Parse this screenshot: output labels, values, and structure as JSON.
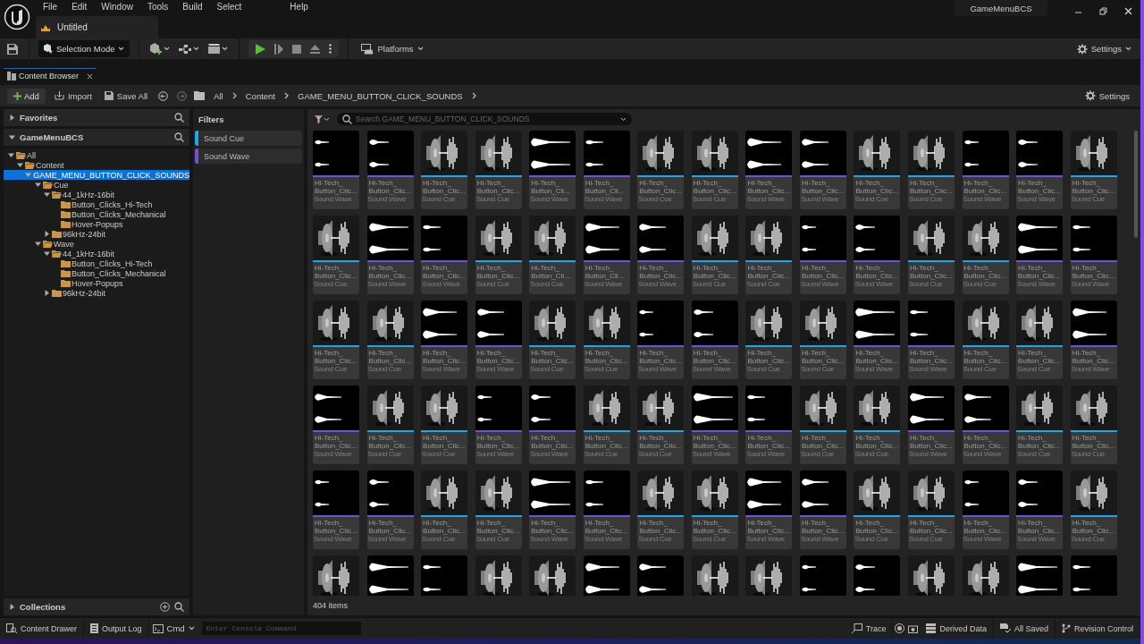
{
  "menu": [
    "File",
    "Edit",
    "Window",
    "Tools",
    "Build",
    "Select",
    "Help"
  ],
  "document_tab": {
    "title": "Untitled"
  },
  "project": "GameMenuBCS",
  "toolbar": {
    "mode": "Selection Mode",
    "platforms": "Platforms",
    "settings": "Settings"
  },
  "panel_tab": {
    "title": "Content Browser",
    "selected": true
  },
  "browser_toolbar": {
    "add": "Add",
    "import": "Import",
    "save_all": "Save All",
    "breadcrumb": [
      "All",
      "Content",
      "GAME_MENU_BUTTON_CLICK_SOUNDS"
    ],
    "settings": "Settings"
  },
  "sources": {
    "favorites": {
      "title": "Favorites",
      "expanded": false
    },
    "project": {
      "title": "GameMenuBCS",
      "expanded": true
    },
    "collections": {
      "title": "Collections",
      "expanded": false
    }
  },
  "tree": [
    {
      "label": "All",
      "expanded": true,
      "selected": false,
      "children": [
        {
          "label": "Content",
          "expanded": true,
          "selected": false,
          "children": [
            {
              "label": "GAME_MENU_BUTTON_CLICK_SOUNDS",
              "expanded": true,
              "selected": true,
              "children": [
                {
                  "label": "Cue",
                  "expanded": true,
                  "selected": false,
                  "children": [
                    {
                      "label": "44_1kHz-16bit",
                      "expanded": true,
                      "selected": false,
                      "children": [
                        {
                          "label": "Button_Clicks_Hi-Tech",
                          "selected": false
                        },
                        {
                          "label": "Button_Clicks_Mechanical",
                          "selected": false
                        },
                        {
                          "label": "Hover-Popups",
                          "selected": false
                        }
                      ]
                    },
                    {
                      "label": "96kHz-24bit",
                      "expanded": false,
                      "selected": false
                    }
                  ]
                },
                {
                  "label": "Wave",
                  "expanded": true,
                  "selected": false,
                  "children": [
                    {
                      "label": "44_1kHz-16bit",
                      "expanded": true,
                      "selected": false,
                      "children": [
                        {
                          "label": "Button_Clicks_Hi-Tech",
                          "selected": false
                        },
                        {
                          "label": "Button_Clicks_Mechanical",
                          "selected": false
                        },
                        {
                          "label": "Hover-Popups",
                          "selected": false
                        }
                      ]
                    },
                    {
                      "label": "96kHz-24bit",
                      "expanded": false,
                      "selected": false
                    }
                  ]
                }
              ]
            }
          ]
        }
      ]
    }
  ],
  "filters": {
    "title": "Filters",
    "items": [
      {
        "label": "Sound Cue",
        "color": "#1ea7e8"
      },
      {
        "label": "Sound Wave",
        "color": "#7350d8"
      }
    ]
  },
  "search": {
    "placeholder": "Search GAME_MENU_BUTTON_CLICK_SOUNDS"
  },
  "assets": [
    {
      "kind": "wave",
      "name": "Hi-Tech_",
      "name2": "Button_Clic...",
      "type": "Sound Wave"
    },
    {
      "kind": "wave",
      "name": "Hi-Tech_",
      "name2": "Button_Clic...",
      "type": "Sound Wave"
    },
    {
      "kind": "cue",
      "name": "Hi-Tech_",
      "name2": "Button_Clic...",
      "type": "Sound Cue"
    },
    {
      "kind": "cue",
      "name": "Hi-Tech_",
      "name2": "Button_Clic...",
      "type": "Sound Cue"
    },
    {
      "kind": "wave",
      "name": "Hi-Tech_",
      "name2": "Button_Cli...",
      "type": "Sound Wave"
    },
    {
      "kind": "wave",
      "name": "Hi-Tech_",
      "name2": "Button_Cli...",
      "type": "Sound Wave"
    },
    {
      "kind": "cue",
      "name": "Hi-Tech_",
      "name2": "Button_Clic...",
      "type": "Sound Cue"
    },
    {
      "kind": "cue",
      "name": "Hi-Tech_",
      "name2": "Button_Clic...",
      "type": "Sound Cue"
    },
    {
      "kind": "wave",
      "name": "Hi-Tech_",
      "name2": "Button_Clic...",
      "type": "Sound Wave"
    },
    {
      "kind": "wave",
      "name": "Hi-Tech_",
      "name2": "Button_Clic...",
      "type": "Sound Wave"
    },
    {
      "kind": "cue",
      "name": "Hi-Tech_",
      "name2": "Button_Clic...",
      "type": "Sound Cue"
    },
    {
      "kind": "cue",
      "name": "Hi-Tech_",
      "name2": "Button_Clic...",
      "type": "Sound Cue"
    },
    {
      "kind": "wave",
      "name": "Hi-Tech_",
      "name2": "Button_Clic...",
      "type": "Sound Wave"
    },
    {
      "kind": "wave",
      "name": "Hi-Tech_",
      "name2": "Button_Clic...",
      "type": "Sound Wave"
    },
    {
      "kind": "cue",
      "name": "Hi-Tech_",
      "name2": "Button_Clic...",
      "type": "Sound Cue"
    },
    {
      "kind": "cue",
      "name": "Hi-Tech_",
      "name2": "Button_Clic...",
      "type": "Sound Cue"
    },
    {
      "kind": "wave",
      "name": "Hi-Tech_",
      "name2": "Button_Clic...",
      "type": "Sound Wave"
    },
    {
      "kind": "wave",
      "name": "Hi-Tech_",
      "name2": "Button_Clic...",
      "type": "Sound Wave"
    },
    {
      "kind": "cue",
      "name": "Hi-Tech_",
      "name2": "Button_Clic...",
      "type": "Sound Cue"
    },
    {
      "kind": "cue",
      "name": "Hi-Tech_",
      "name2": "Button_Cli...",
      "type": "Sound Cue"
    },
    {
      "kind": "wave",
      "name": "Hi-Tech_",
      "name2": "Button_Cli...",
      "type": "Sound Wave"
    },
    {
      "kind": "wave",
      "name": "Hi-Tech_",
      "name2": "Button_Clic...",
      "type": "Sound Wave"
    },
    {
      "kind": "cue",
      "name": "Hi-Tech_",
      "name2": "Button_Clic...",
      "type": "Sound Cue"
    },
    {
      "kind": "cue",
      "name": "Hi-Tech_",
      "name2": "Button_Clic...",
      "type": "Sound Cue"
    },
    {
      "kind": "wave",
      "name": "Hi-Tech_",
      "name2": "Button_Clic...",
      "type": "Sound Wave"
    },
    {
      "kind": "wave",
      "name": "Hi-Tech_",
      "name2": "Button_Clic...",
      "type": "Sound Wave"
    },
    {
      "kind": "cue",
      "name": "Hi-Tech_",
      "name2": "Button_Clic...",
      "type": "Sound Cue"
    },
    {
      "kind": "cue",
      "name": "Hi-Tech_",
      "name2": "Button_Clic...",
      "type": "Sound Cue"
    },
    {
      "kind": "wave",
      "name": "Hi-Tech_",
      "name2": "Button_Clic...",
      "type": "Sound Wave"
    },
    {
      "kind": "wave",
      "name": "Hi-Tech_",
      "name2": "Button_Clic...",
      "type": "Sound Wave"
    },
    {
      "kind": "cue",
      "name": "Hi-Tech_",
      "name2": "Button_Clic...",
      "type": "Sound Cue"
    },
    {
      "kind": "cue",
      "name": "Hi-Tech_",
      "name2": "Button_Clic...",
      "type": "Sound Cue"
    },
    {
      "kind": "wave",
      "name": "Hi-Tech_",
      "name2": "Button_Clic...",
      "type": "Sound Wave"
    },
    {
      "kind": "wave",
      "name": "Hi-Tech_",
      "name2": "Button_Clic...",
      "type": "Sound Wave"
    },
    {
      "kind": "cue",
      "name": "Hi-Tech_",
      "name2": "Button_Clic...",
      "type": "Sound Cue"
    },
    {
      "kind": "cue",
      "name": "Hi-Tech_",
      "name2": "Button_Clic...",
      "type": "Sound Cue"
    },
    {
      "kind": "wave",
      "name": "Hi-Tech_",
      "name2": "Button_Clic...",
      "type": "Sound Wave"
    },
    {
      "kind": "wave",
      "name": "Hi-Tech_",
      "name2": "Button_Clic...",
      "type": "Sound Wave"
    },
    {
      "kind": "cue",
      "name": "Hi-Tech_",
      "name2": "Button_Clic...",
      "type": "Sound Cue"
    },
    {
      "kind": "cue",
      "name": "Hi-Tech_",
      "name2": "Button_Clic...",
      "type": "Sound Cue"
    },
    {
      "kind": "wave",
      "name": "Hi-Tech_",
      "name2": "Button_Clic...",
      "type": "Sound Wave"
    },
    {
      "kind": "wave",
      "name": "Hi-Tech_",
      "name2": "Button_Clic...",
      "type": "Sound Wave"
    },
    {
      "kind": "cue",
      "name": "Hi-Tech_",
      "name2": "Button_Clic...",
      "type": "Sound Cue"
    },
    {
      "kind": "cue",
      "name": "Hi-Tech_",
      "name2": "Button_Clic...",
      "type": "Sound Cue"
    },
    {
      "kind": "wave",
      "name": "Hi-Tech_",
      "name2": "Button_Clic...",
      "type": "Sound Wave"
    },
    {
      "kind": "wave",
      "name": "Hi-Tech_",
      "name2": "Button_Clic...",
      "type": "Sound Wave"
    },
    {
      "kind": "cue",
      "name": "Hi-Tech_",
      "name2": "Button_Clic...",
      "type": "Sound Cue"
    },
    {
      "kind": "cue",
      "name": "Hi-Tech_",
      "name2": "Button_Clic...",
      "type": "Sound Cue"
    },
    {
      "kind": "wave",
      "name": "Hi-Tech_",
      "name2": "Button_Clic...",
      "type": "Sound Wave"
    },
    {
      "kind": "wave",
      "name": "Hi-Tech_",
      "name2": "Button_Clic...",
      "type": "Sound Wave"
    },
    {
      "kind": "cue",
      "name": "Hi-Tech_",
      "name2": "Button_Clic...",
      "type": "Sound Cue"
    },
    {
      "kind": "cue",
      "name": "Hi-Tech_",
      "name2": "Button_Clic...",
      "type": "Sound Cue"
    },
    {
      "kind": "wave",
      "name": "Hi-Tech_",
      "name2": "Button_Clic...",
      "type": "Sound Wave"
    },
    {
      "kind": "wave",
      "name": "Hi-Tech_",
      "name2": "Button_Clic...",
      "type": "Sound Wave"
    },
    {
      "kind": "cue",
      "name": "Hi-Tech_",
      "name2": "Button_Clic...",
      "type": "Sound Cue"
    },
    {
      "kind": "cue",
      "name": "Hi-Tech_",
      "name2": "Button_Clic...",
      "type": "Sound Cue"
    },
    {
      "kind": "wave",
      "name": "Hi-Tech_",
      "name2": "Button_Clic...",
      "type": "Sound Wave"
    },
    {
      "kind": "wave",
      "name": "Hi-Tech_",
      "name2": "Button_Clic...",
      "type": "Sound Wave"
    },
    {
      "kind": "cue",
      "name": "Hi-Tech_",
      "name2": "Button_Clic...",
      "type": "Sound Cue"
    },
    {
      "kind": "cue",
      "name": "Hi-Tech_",
      "name2": "Button_Clic...",
      "type": "Sound Cue"
    },
    {
      "kind": "wave",
      "name": "Hi-Tech_",
      "name2": "Button_Clic...",
      "type": "Sound Wave"
    },
    {
      "kind": "wave",
      "name": "Hi-Tech_",
      "name2": "Button_Clic...",
      "type": "Sound Wave"
    },
    {
      "kind": "cue",
      "name": "Hi-Tech_",
      "name2": "Button_Clic...",
      "type": "Sound Cue"
    },
    {
      "kind": "cue",
      "name": "Hi-Tech_",
      "name2": "Button_Clic...",
      "type": "Sound Cue"
    },
    {
      "kind": "wave",
      "name": "Hi-Tech_",
      "name2": "Button_Clic...",
      "type": "Sound Wave"
    },
    {
      "kind": "wave",
      "name": "Hi-Tech_",
      "name2": "Button_Clic...",
      "type": "Sound Wave"
    },
    {
      "kind": "cue",
      "name": "Hi-Tech_",
      "name2": "Button_Clic...",
      "type": "Sound Cue"
    },
    {
      "kind": "cue",
      "name": "Hi-Tech_",
      "name2": "Button_Clic...",
      "type": "Sound Cue"
    },
    {
      "kind": "wave",
      "name": "Hi-Tech_",
      "name2": "Button_Clic...",
      "type": "Sound Wave"
    },
    {
      "kind": "wave",
      "name": "Hi-Tech_",
      "name2": "Button_Clic...",
      "type": "Sound Wave"
    },
    {
      "kind": "cue",
      "name": "Hi-Tech_",
      "name2": "Button_Clic...",
      "type": "Sound Cue"
    },
    {
      "kind": "cue",
      "name": "Hi-Tech_",
      "name2": "Button_Clic...",
      "type": "Sound Cue"
    },
    {
      "kind": "wave",
      "name": "Hi-Tech_",
      "name2": "Button_Clic...",
      "type": "Sound Wave"
    },
    {
      "kind": "wave",
      "name": "Hi-Tech_",
      "name2": "Button_Clic...",
      "type": "Sound Wave"
    },
    {
      "kind": "cue",
      "name": "Hi-Tech_",
      "name2": "Button_Clic...",
      "type": "Sound Cue"
    },
    {
      "kind": "cue"
    },
    {
      "kind": "wave"
    },
    {
      "kind": "wave"
    },
    {
      "kind": "cue"
    },
    {
      "kind": "cue"
    },
    {
      "kind": "wave"
    },
    {
      "kind": "wave"
    },
    {
      "kind": "cue"
    },
    {
      "kind": "cue"
    },
    {
      "kind": "wave"
    },
    {
      "kind": "wave"
    },
    {
      "kind": "cue"
    },
    {
      "kind": "cue"
    },
    {
      "kind": "wave"
    },
    {
      "kind": "wave"
    }
  ],
  "item_count": "404 items",
  "status_bar": {
    "content_drawer": "Content Drawer",
    "output_log": "Output Log",
    "cmd": "Cmd",
    "console_placeholder": "Enter Console Command",
    "trace": "Trace",
    "derived_data": "Derived Data",
    "saved": "All Saved",
    "revision_control": "Revision Control"
  }
}
